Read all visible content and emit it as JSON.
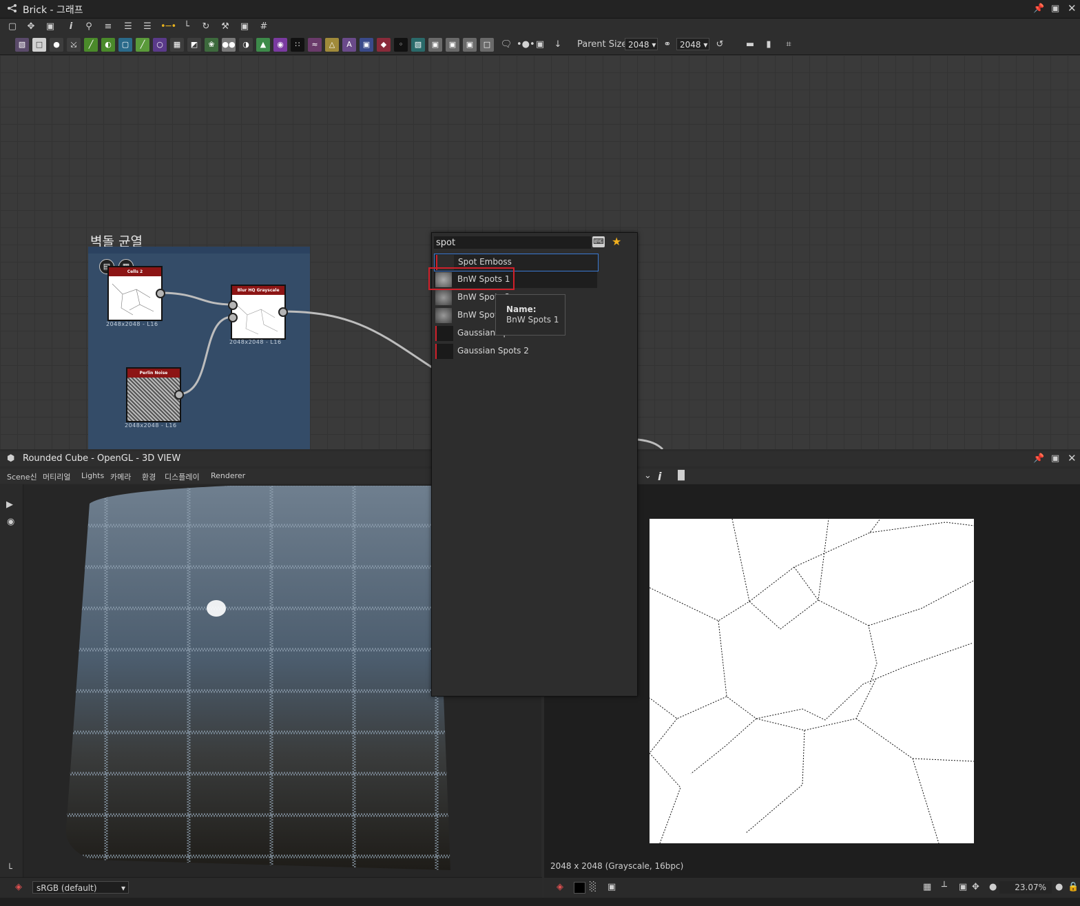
{
  "graph_window": {
    "title": "Brick - 그래프",
    "parent_size_label": "Parent Size:",
    "parent_size_w": "2048",
    "parent_size_h": "2048"
  },
  "frame": {
    "title": "벽돌 균열",
    "nodes": [
      {
        "id": "cells",
        "header": "Cells 2",
        "size_label": "2048x2048 - L16"
      },
      {
        "id": "blur",
        "header": "Blur HQ Grayscale",
        "size_label": "2048x2048 - L16"
      },
      {
        "id": "perlin",
        "header": "Perlin Noise",
        "size_label": "2048x2048 - L16"
      }
    ]
  },
  "search_popup": {
    "query": "spot",
    "results": [
      {
        "label": "Spot Emboss"
      },
      {
        "label": "BnW Spots 1"
      },
      {
        "label": "BnW Spots 2"
      },
      {
        "label": "BnW Spots 3"
      },
      {
        "label": "Gaussian Spots 1"
      },
      {
        "label": "Gaussian Spots 2"
      }
    ],
    "tooltip": {
      "name_label": "Name:",
      "name_value": "BnW Spots 1"
    }
  },
  "view3d": {
    "title": "Rounded Cube - OpenGL - 3D VIEW",
    "menu": [
      "Scene신",
      "머티리얼",
      "Lights",
      "카메라",
      "환경",
      "디스플레이",
      "Renderer"
    ],
    "colorspace": "sRGB (default)"
  },
  "view2d": {
    "info": "2048 x 2048 (Grayscale, 16bpc)",
    "zoom": "23.07%"
  },
  "colors": {
    "accent_red": "#d0202a",
    "node_header": "#8c1515",
    "frame_bg": "#344c68",
    "star": "#f2b01e"
  }
}
